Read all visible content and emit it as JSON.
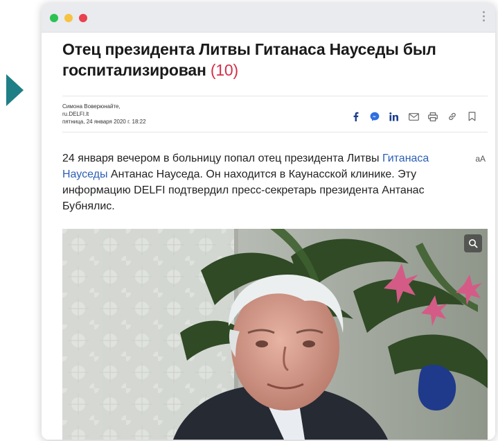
{
  "colors": {
    "accent_arrow": "#1f7f86",
    "traffic_green": "#2bc253",
    "traffic_yellow": "#f6c343",
    "traffic_red": "#e9414f",
    "comment_count": "#d3304a",
    "link": "#2c5fb6"
  },
  "article": {
    "headline": "Отец президента Литвы Гитанаса Науседы был госпитализирован",
    "comment_count": "(10)",
    "author": "Симона Воверюнайте,",
    "source": "ru.DELFI.lt",
    "date": "пятница, 24 января 2020 г. 18:22",
    "lead_1": "24 января вечером в больницу попал отец президента Литвы ",
    "lead_link": "Гитанаса Науседы",
    "lead_2": " Антанас Науседа. Он находится в Каунасской клинике. Эту информацию DELFI подтвердил пресс-секретарь президента Антанас Бубнялис.",
    "font_size_toggle": "aA"
  },
  "share_icons": [
    "facebook-icon",
    "messenger-icon",
    "linkedin-icon",
    "email-icon",
    "print-icon",
    "link-icon",
    "bookmark-icon"
  ]
}
